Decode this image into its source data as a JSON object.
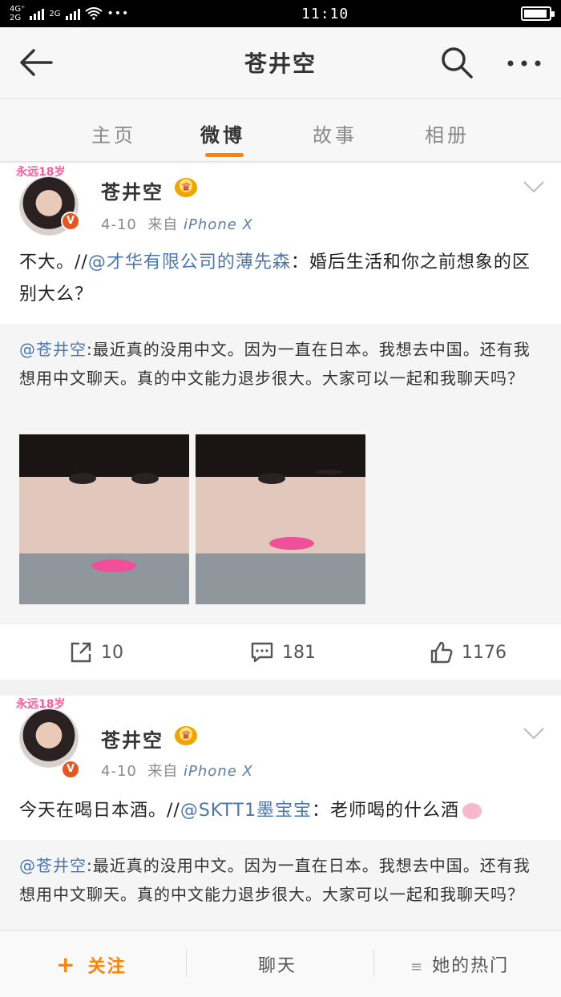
{
  "status_bar": {
    "network_top": "4G⁺",
    "network_bottom": "2G",
    "network_extra": "2G",
    "more": "•••",
    "time": "11:10",
    "battery_level": 0.95
  },
  "nav": {
    "title": "苍井空"
  },
  "tabs": [
    {
      "label": "主页"
    },
    {
      "label": "微博",
      "active": true
    },
    {
      "label": "故事"
    },
    {
      "label": "相册"
    }
  ],
  "avatar_badge": "永远18岁",
  "posts": [
    {
      "user": "苍井空",
      "date": "4-10",
      "from": "来自",
      "source": "iPhone X",
      "text_plain": "不大。//",
      "text_mention": "@才华有限公司的薄先森",
      "text_rest": "：婚后生活和你之前想象的区别大么？",
      "repost_mention": "@苍井空",
      "repost_text": ":最近真的没用中文。因为一直在日本。我想去中国。还有我想用中文聊天。真的中文能力退步很大。大家可以一起和我聊天吗？",
      "reposts": "10",
      "comments": "181",
      "likes": "1176"
    },
    {
      "user": "苍井空",
      "date": "4-10",
      "from": "来自",
      "source": "iPhone X",
      "text_plain": "今天在喝日本酒。//",
      "text_mention": "@SKTT1墨宝宝",
      "text_rest": "：老师喝的什么酒",
      "repost_mention": "@苍井空",
      "repost_text": ":最近真的没用中文。因为一直在日本。我想去中国。还有我想用中文聊天。真的中文能力退步很大。大家可以一起和我聊天吗？"
    }
  ],
  "bottom_bar": {
    "follow_plus": "+",
    "follow": "关注",
    "chat": "聊天",
    "menu_icon": "≡",
    "hot": "她的热门"
  },
  "colors": {
    "accent": "#ff8200",
    "link": "#4b76ad",
    "verified": "#e8561f"
  }
}
